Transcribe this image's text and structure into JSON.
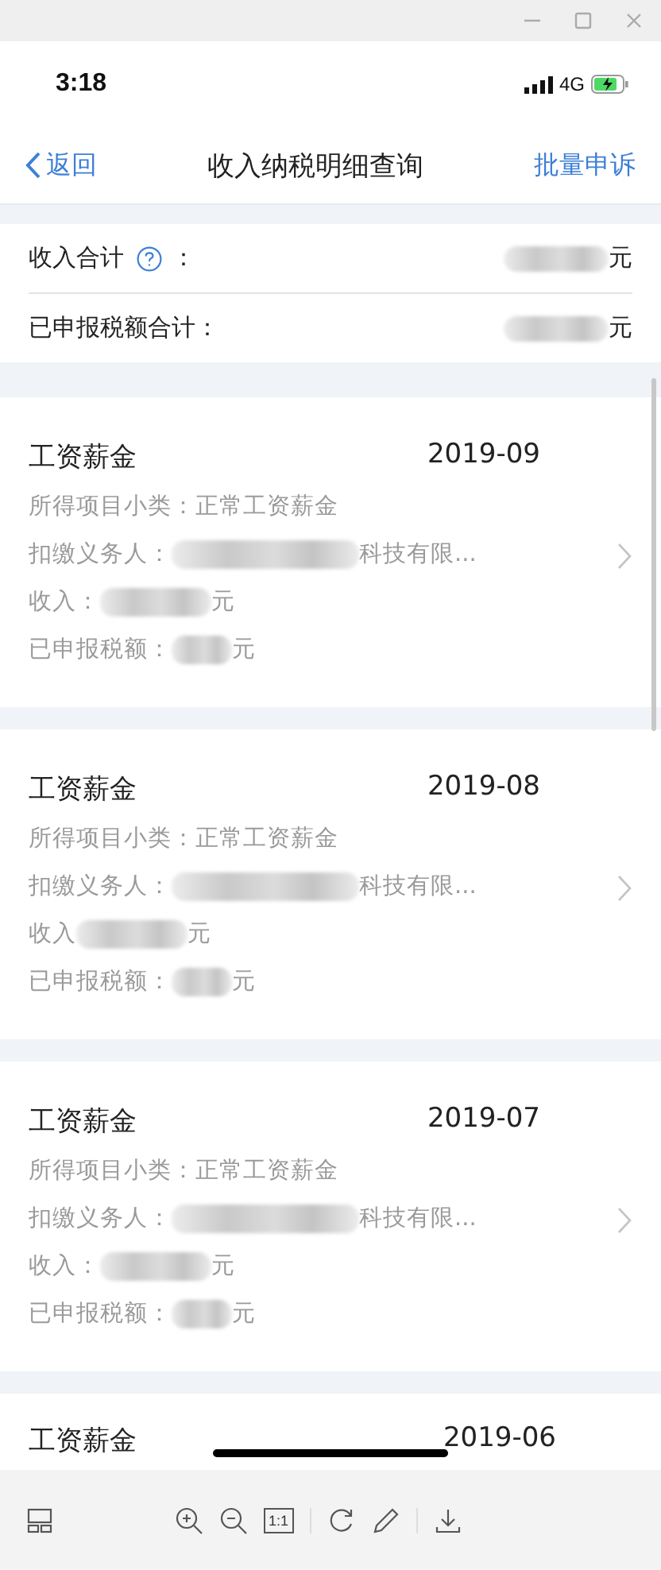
{
  "status_bar": {
    "time": "3:18",
    "network": "4G",
    "charging": true
  },
  "nav": {
    "back": "返回",
    "title": "收入纳税明细查询",
    "action": "批量申诉"
  },
  "summary": [
    {
      "label": "收入合计",
      "help": true,
      "colon": "：",
      "unit": "元"
    },
    {
      "label": "已申报税额合计：",
      "help": false,
      "unit": "元"
    }
  ],
  "records": [
    {
      "category": "工资薪金",
      "period": "2019-09",
      "fields": [
        {
          "label": "所得项目小类：",
          "value": "正常工资薪金"
        },
        {
          "label": "扣缴义务人：",
          "redacted": true,
          "value": "科技有限..."
        },
        {
          "label": "收入：",
          "redacted": true,
          "value": "元"
        },
        {
          "label": "已申报税额：",
          "redacted": true,
          "value": "元"
        }
      ]
    },
    {
      "category": "工资薪金",
      "period": "2019-08",
      "fields": [
        {
          "label": "所得项目小类：",
          "value": "正常工资薪金"
        },
        {
          "label": "扣缴义务人：",
          "redacted": true,
          "value": "科技有限..."
        },
        {
          "label": "收入",
          "redacted": true,
          "value": "元"
        },
        {
          "label": "已申报税额：",
          "redacted": true,
          "value": "元"
        }
      ]
    },
    {
      "category": "工资薪金",
      "period": "2019-07",
      "fields": [
        {
          "label": "所得项目小类：",
          "value": "正常工资薪金"
        },
        {
          "label": "扣缴义务人：",
          "redacted": true,
          "value": "科技有限..."
        },
        {
          "label": "收入：",
          "redacted": true,
          "value": "元"
        },
        {
          "label": "已申报税额：",
          "redacted": true,
          "value": "元"
        }
      ]
    },
    {
      "category": "工资薪金",
      "period": "2019-06"
    }
  ],
  "toolbar": {
    "actual_size": "1:1"
  }
}
